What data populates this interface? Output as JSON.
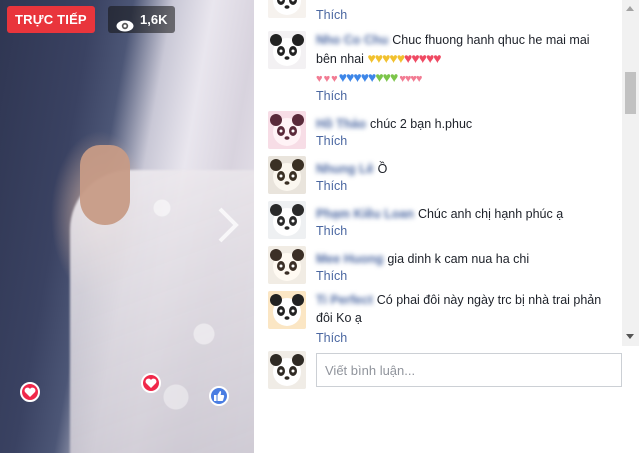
{
  "live": {
    "badge_label": "TRỰC TIẾP",
    "viewer_count": "1,6K"
  },
  "colors": {
    "live_red": "#e9353c",
    "link_blue": "#4b67a1",
    "heart": "#f0284a",
    "like": "#4a7de2"
  },
  "comments": [
    {
      "name": "",
      "text": "",
      "like_label": "Thích"
    },
    {
      "name": "Nho Co Chu",
      "text": "Chuc fhuong hanh qhuc he mai mai bên nhai",
      "like_label": "Thích"
    },
    {
      "name": "Hồ Thảo",
      "text": "chúc 2 bạn h.phuc",
      "like_label": "Thích"
    },
    {
      "name": "Nhung Lê",
      "text": "Ồ",
      "like_label": "Thích"
    },
    {
      "name": "Phạm Kiều Loan",
      "text": "Chúc anh chị hạnh phúc ạ",
      "like_label": "Thích"
    },
    {
      "name": "Mee Huong",
      "text": "gia dinh k cam nua ha chi",
      "like_label": "Thích"
    },
    {
      "name": "Ti Perfect",
      "text": "Có phai đôi này ngày trc bị nhà trai phản đôi Ko ạ",
      "like_label": "Thích"
    }
  ],
  "composer": {
    "placeholder": "Viết bình luận..."
  },
  "icons": [
    "eye-icon",
    "chevron-right-icon",
    "heart-reaction-icon",
    "like-reaction-icon",
    "panda-avatar"
  ]
}
